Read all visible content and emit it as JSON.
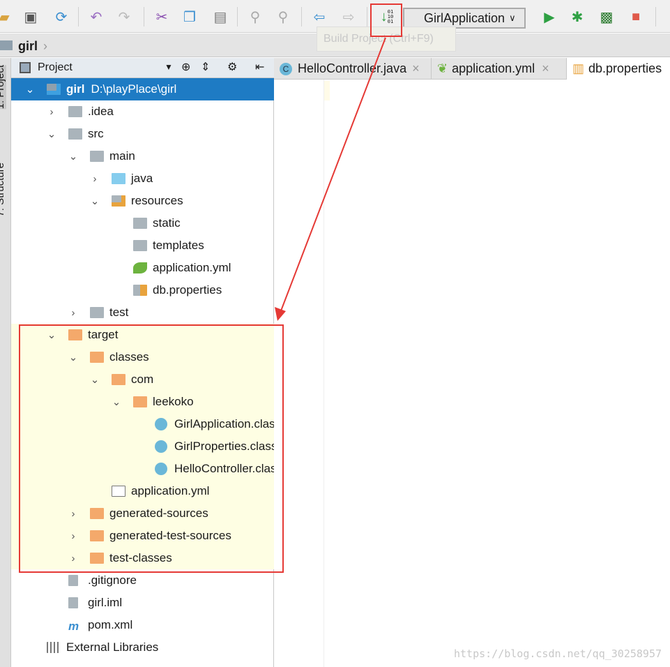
{
  "toolbar": {
    "icons": [
      "open-icon",
      "save-icon",
      "sync-icon",
      "undo-icon",
      "redo-icon",
      "cut-icon",
      "copy-icon",
      "paste-icon",
      "find-icon",
      "replace-icon",
      "back-icon",
      "forward-icon",
      "build-icon",
      "run-icon",
      "debug-icon",
      "coverage-icon",
      "stop-icon"
    ],
    "run_config": "GirlApplication",
    "build_glyph": "01\n10\n01",
    "tooltip": "Build Project (Ctrl+F9)"
  },
  "breadcrumb": {
    "label": "girl"
  },
  "side_tabs": {
    "project": "1: Project",
    "structure": "7: Structure"
  },
  "project_panel": {
    "title": "Project"
  },
  "tree": [
    {
      "label": "girl",
      "path": "D:\\playPlace\\girl",
      "level": 0,
      "icon": "module",
      "expanded": true,
      "selected": true
    },
    {
      "label": ".idea",
      "level": 1,
      "icon": "folder",
      "expanded": false
    },
    {
      "label": "src",
      "level": 1,
      "icon": "folder",
      "expanded": true
    },
    {
      "label": "main",
      "level": 2,
      "icon": "folder",
      "expanded": true
    },
    {
      "label": "java",
      "level": 3,
      "icon": "source-folder",
      "expanded": false
    },
    {
      "label": "resources",
      "level": 3,
      "icon": "resources-folder",
      "expanded": true
    },
    {
      "label": "static",
      "level": 4,
      "icon": "web-folder"
    },
    {
      "label": "templates",
      "level": 4,
      "icon": "web-folder"
    },
    {
      "label": "application.yml",
      "level": 4,
      "icon": "spring-file"
    },
    {
      "label": "db.properties",
      "level": 4,
      "icon": "properties-file"
    },
    {
      "label": "test",
      "level": 2,
      "icon": "folder",
      "expanded": false
    },
    {
      "label": "target",
      "level": 1,
      "icon": "excluded-folder",
      "expanded": true
    },
    {
      "label": "classes",
      "level": 2,
      "icon": "excluded-folder",
      "expanded": true
    },
    {
      "label": "com",
      "level": 3,
      "icon": "excluded-folder",
      "expanded": true
    },
    {
      "label": "leekoko",
      "level": 4,
      "icon": "excluded-folder",
      "expanded": true
    },
    {
      "label": "GirlApplication.class",
      "level": 5,
      "icon": "class-file"
    },
    {
      "label": "GirlProperties.class",
      "level": 5,
      "icon": "class-file"
    },
    {
      "label": "HelloController.class",
      "level": 5,
      "icon": "class-file"
    },
    {
      "label": "application.yml",
      "level": 3,
      "icon": "yml-file"
    },
    {
      "label": "generated-sources",
      "level": 2,
      "icon": "excluded-folder",
      "expanded": false
    },
    {
      "label": "generated-test-sources",
      "level": 2,
      "icon": "excluded-folder",
      "expanded": false
    },
    {
      "label": "test-classes",
      "level": 2,
      "icon": "excluded-folder",
      "expanded": false
    },
    {
      "label": ".gitignore",
      "level": 1,
      "icon": "text-file"
    },
    {
      "label": "girl.iml",
      "level": 1,
      "icon": "iml-file"
    },
    {
      "label": "pom.xml",
      "level": 1,
      "icon": "maven-file"
    },
    {
      "label": "External Libraries",
      "level": 0,
      "icon": "libraries"
    }
  ],
  "editor_tabs": [
    {
      "label": "HelloController.java",
      "icon": "class-icon"
    },
    {
      "label": "application.yml",
      "icon": "spring-icon"
    },
    {
      "label": "db.properties",
      "icon": "properties-icon",
      "active": true
    }
  ],
  "annotation_color": "#e53935",
  "watermark": "https://blog.csdn.net/qq_30258957"
}
